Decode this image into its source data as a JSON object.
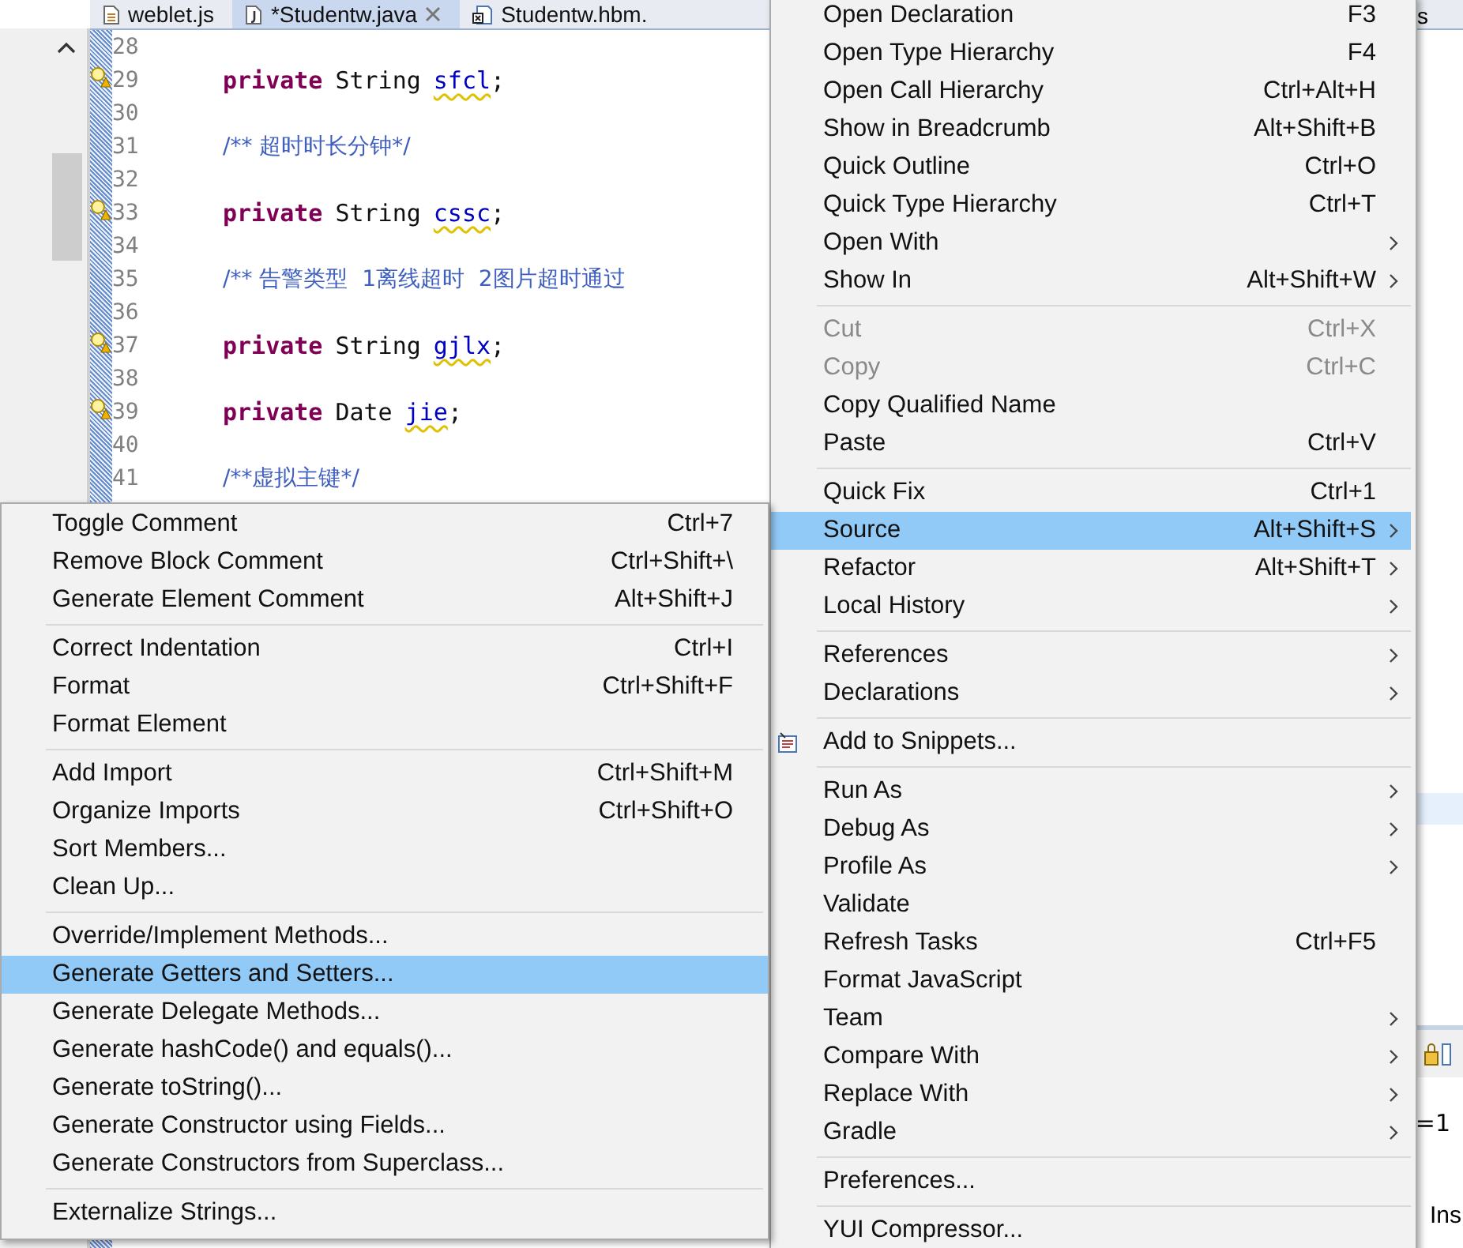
{
  "editor_tabs": [
    {
      "label": "weblet.js",
      "kind": "js",
      "selected": false,
      "closable": false
    },
    {
      "label": "*Studentw.java",
      "kind": "java",
      "selected": true,
      "closable": true
    },
    {
      "label": "Studentw.hbm.",
      "kind": "xml",
      "selected": false,
      "closable": false
    }
  ],
  "code_lines": [
    {
      "number": "28",
      "kind": "blank",
      "warning": false
    },
    {
      "number": "29",
      "kind": "field",
      "warning": true,
      "keyword": "private",
      "type": "String",
      "name": "sfcl",
      "end": ";"
    },
    {
      "number": "30",
      "kind": "blank",
      "warning": false
    },
    {
      "number": "31",
      "kind": "comment",
      "warning": false,
      "text": "/** 超时时长分钟*/"
    },
    {
      "number": "32",
      "kind": "blank",
      "warning": false
    },
    {
      "number": "33",
      "kind": "field",
      "warning": true,
      "keyword": "private",
      "type": "String",
      "name": "cssc",
      "end": ";"
    },
    {
      "number": "34",
      "kind": "blank",
      "warning": false
    },
    {
      "number": "35",
      "kind": "comment",
      "warning": false,
      "text": "/** 告警类型  1离线超时  2图片超时通过"
    },
    {
      "number": "36",
      "kind": "blank",
      "warning": false
    },
    {
      "number": "37",
      "kind": "field",
      "warning": true,
      "keyword": "private",
      "type": "String",
      "name": "gjlx",
      "end": ";"
    },
    {
      "number": "38",
      "kind": "blank",
      "warning": false
    },
    {
      "number": "39",
      "kind": "field",
      "warning": true,
      "keyword": "private",
      "type": "Date",
      "name": "jie",
      "end": ";"
    },
    {
      "number": "40",
      "kind": "blank",
      "warning": false
    },
    {
      "number": "41",
      "kind": "comment",
      "warning": false,
      "text": "/**虚拟主键*/"
    }
  ],
  "background_fragments": [
    {
      "text": "s",
      "kind": "tab"
    },
    {
      "text": "=1",
      "kind": "field"
    },
    {
      "text": "Ins",
      "kind": "status"
    }
  ],
  "context_menu": [
    {
      "kind": "item",
      "label": "Open Declaration",
      "shortcut": "F3",
      "submenu": false,
      "disabled": false,
      "selected": false
    },
    {
      "kind": "item",
      "label": "Open Type Hierarchy",
      "shortcut": "F4",
      "submenu": false,
      "disabled": false,
      "selected": false
    },
    {
      "kind": "item",
      "label": "Open Call Hierarchy",
      "shortcut": "Ctrl+Alt+H",
      "submenu": false,
      "disabled": false,
      "selected": false
    },
    {
      "kind": "item",
      "label": "Show in Breadcrumb",
      "shortcut": "Alt+Shift+B",
      "submenu": false,
      "disabled": false,
      "selected": false
    },
    {
      "kind": "item",
      "label": "Quick Outline",
      "shortcut": "Ctrl+O",
      "submenu": false,
      "disabled": false,
      "selected": false
    },
    {
      "kind": "item",
      "label": "Quick Type Hierarchy",
      "shortcut": "Ctrl+T",
      "submenu": false,
      "disabled": false,
      "selected": false
    },
    {
      "kind": "item",
      "label": "Open With",
      "submenu": true,
      "disabled": false,
      "selected": false
    },
    {
      "kind": "item",
      "label": "Show In",
      "shortcut": "Alt+Shift+W",
      "submenu": true,
      "disabled": false,
      "selected": false
    },
    {
      "kind": "separator"
    },
    {
      "kind": "item",
      "label": "Cut",
      "shortcut": "Ctrl+X",
      "submenu": false,
      "disabled": true,
      "selected": false
    },
    {
      "kind": "item",
      "label": "Copy",
      "shortcut": "Ctrl+C",
      "submenu": false,
      "disabled": true,
      "selected": false
    },
    {
      "kind": "item",
      "label": "Copy Qualified Name",
      "submenu": false,
      "disabled": false,
      "selected": false
    },
    {
      "kind": "item",
      "label": "Paste",
      "shortcut": "Ctrl+V",
      "submenu": false,
      "disabled": false,
      "selected": false
    },
    {
      "kind": "separator"
    },
    {
      "kind": "item",
      "label": "Quick Fix",
      "shortcut": "Ctrl+1",
      "submenu": false,
      "disabled": false,
      "selected": false
    },
    {
      "kind": "item",
      "label": "Source",
      "shortcut": "Alt+Shift+S",
      "submenu": true,
      "disabled": false,
      "selected": true
    },
    {
      "kind": "item",
      "label": "Refactor",
      "shortcut": "Alt+Shift+T",
      "submenu": true,
      "disabled": false,
      "selected": false
    },
    {
      "kind": "item",
      "label": "Local History",
      "submenu": true,
      "disabled": false,
      "selected": false
    },
    {
      "kind": "separator"
    },
    {
      "kind": "item",
      "label": "References",
      "submenu": true,
      "disabled": false,
      "selected": false
    },
    {
      "kind": "item",
      "label": "Declarations",
      "submenu": true,
      "disabled": false,
      "selected": false
    },
    {
      "kind": "separator"
    },
    {
      "kind": "item",
      "label": "Add to Snippets...",
      "submenu": false,
      "disabled": false,
      "selected": false,
      "has_icon": true
    },
    {
      "kind": "separator"
    },
    {
      "kind": "item",
      "label": "Run As",
      "submenu": true,
      "disabled": false,
      "selected": false
    },
    {
      "kind": "item",
      "label": "Debug As",
      "submenu": true,
      "disabled": false,
      "selected": false
    },
    {
      "kind": "item",
      "label": "Profile As",
      "submenu": true,
      "disabled": false,
      "selected": false
    },
    {
      "kind": "item",
      "label": "Validate",
      "submenu": false,
      "disabled": false,
      "selected": false
    },
    {
      "kind": "item",
      "label": "Refresh Tasks",
      "shortcut": "Ctrl+F5",
      "submenu": false,
      "disabled": false,
      "selected": false
    },
    {
      "kind": "item",
      "label": "Format JavaScript",
      "submenu": false,
      "disabled": false,
      "selected": false
    },
    {
      "kind": "item",
      "label": "Team",
      "submenu": true,
      "disabled": false,
      "selected": false
    },
    {
      "kind": "item",
      "label": "Compare With",
      "submenu": true,
      "disabled": false,
      "selected": false
    },
    {
      "kind": "item",
      "label": "Replace With",
      "submenu": true,
      "disabled": false,
      "selected": false
    },
    {
      "kind": "item",
      "label": "Gradle",
      "submenu": true,
      "disabled": false,
      "selected": false
    },
    {
      "kind": "separator"
    },
    {
      "kind": "item",
      "label": "Preferences...",
      "submenu": false,
      "disabled": false,
      "selected": false
    },
    {
      "kind": "separator"
    },
    {
      "kind": "item",
      "label": "YUI Compressor...",
      "submenu": false,
      "disabled": false,
      "selected": false
    }
  ],
  "source_submenu": [
    {
      "kind": "item",
      "label": "Toggle Comment",
      "shortcut": "Ctrl+7",
      "selected": false
    },
    {
      "kind": "item",
      "label": "Remove Block Comment",
      "shortcut": "Ctrl+Shift+\\",
      "selected": false
    },
    {
      "kind": "item",
      "label": "Generate Element Comment",
      "shortcut": "Alt+Shift+J",
      "selected": false
    },
    {
      "kind": "separator"
    },
    {
      "kind": "item",
      "label": "Correct Indentation",
      "shortcut": "Ctrl+I",
      "selected": false
    },
    {
      "kind": "item",
      "label": "Format",
      "shortcut": "Ctrl+Shift+F",
      "selected": false
    },
    {
      "kind": "item",
      "label": "Format Element",
      "selected": false
    },
    {
      "kind": "separator"
    },
    {
      "kind": "item",
      "label": "Add Import",
      "shortcut": "Ctrl+Shift+M",
      "selected": false
    },
    {
      "kind": "item",
      "label": "Organize Imports",
      "shortcut": "Ctrl+Shift+O",
      "selected": false
    },
    {
      "kind": "item",
      "label": "Sort Members...",
      "selected": false
    },
    {
      "kind": "item",
      "label": "Clean Up...",
      "selected": false
    },
    {
      "kind": "separator"
    },
    {
      "kind": "item",
      "label": "Override/Implement Methods...",
      "selected": false
    },
    {
      "kind": "item",
      "label": "Generate Getters and Setters...",
      "selected": true
    },
    {
      "kind": "item",
      "label": "Generate Delegate Methods...",
      "selected": false
    },
    {
      "kind": "item",
      "label": "Generate hashCode() and equals()...",
      "selected": false
    },
    {
      "kind": "item",
      "label": "Generate toString()...",
      "selected": false
    },
    {
      "kind": "item",
      "label": "Generate Constructor using Fields...",
      "selected": false
    },
    {
      "kind": "item",
      "label": "Generate Constructors from Superclass...",
      "selected": false
    },
    {
      "kind": "separator"
    },
    {
      "kind": "item",
      "label": "Externalize Strings...",
      "selected": false
    }
  ]
}
